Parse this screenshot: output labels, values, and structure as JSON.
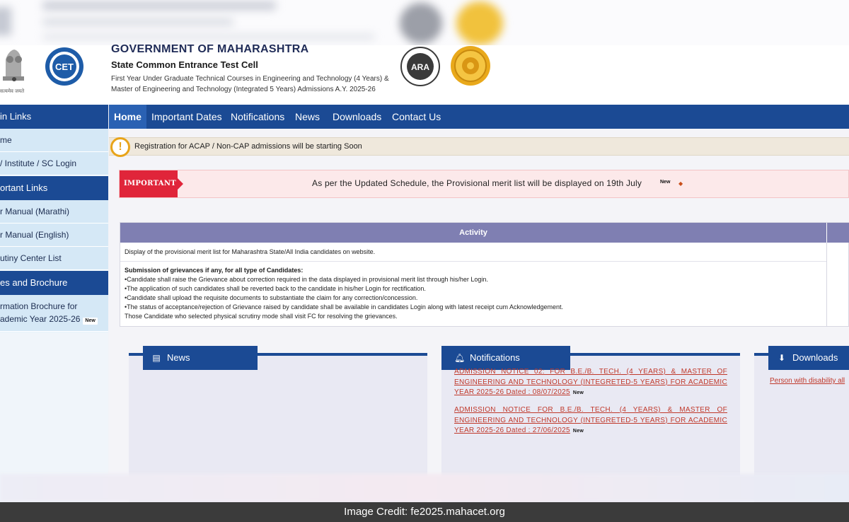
{
  "header": {
    "emblem_caption": "सत्यमेव जयते",
    "government": "GOVERNMENT OF MAHARASHTRA",
    "cell": "State Common Entrance Test Cell",
    "subtitle_line1": "First Year Under Graduate Technical Courses in Engineering and Technology (4 Years) &",
    "subtitle_line2": "Master of Engineering and Technology (Integrated 5 Years) Admissions A.Y. 2025-26",
    "cet_logo_text": "CET",
    "ara_logo_text": "ARA"
  },
  "nav": {
    "items": [
      "Home",
      "Important Dates",
      "Notifications",
      "News",
      "Downloads",
      "Contact Us"
    ]
  },
  "sidebar": {
    "head_main": "in Links",
    "item_home": "me",
    "item_login": "/ Institute / SC Login",
    "head_important": "ortant Links",
    "item_manual_marathi": "r Manual (Marathi)",
    "item_manual_english": "r Manual (English)",
    "item_scrutiny": "utiny Center List",
    "head_brochure": "es and Brochure",
    "item_brochure_line1": "rmation Brochure for",
    "item_brochure_line2": "ademic Year 2025-26",
    "new_label": "New"
  },
  "alert": {
    "text": "Registration for ACAP / Non-CAP admissions will be starting Soon"
  },
  "important": {
    "tag": "IMPORTANT",
    "text": "As per the Updated Schedule, the Provisional merit list will be displayed on 19th July",
    "new_label": "New"
  },
  "activity": {
    "heading": "Activity",
    "row1": "Display of the provisional merit list for Maharashtra State/All India candidates on website.",
    "row2_title": "Submission of grievances if any, for all type of Candidates:",
    "row2_lines": [
      "•Candidate shall raise the Grievance about correction required in the data displayed in provisional merit list through his/her Login.",
      "•The application of such candidates shall be reverted back to the candidate in his/her Login for rectification.",
      "•Candidate shall upload the requisite documents to substantiate the claim for any correction/concession.",
      "•The status of acceptance/rejection of Grievance raised by candidate shall be available in candidates Login along with latest receipt cum Acknowledgement.",
      "Those Candidate who selected physical scrutiny mode shall visit FC for resolving the grievances."
    ]
  },
  "panels": {
    "news_title": "News",
    "notifications_title": "Notifications",
    "downloads_title": "Downloads",
    "notifications": [
      {
        "text": "ADMISSION NOTICE 02: FOR B.E./B. TECH. (4 YEARS) & MASTER OF ENGINEERING AND TECHNOLOGY (INTEGRETED-5 YEARS) FOR ACADEMIC YEAR 2025-26 Dated : 08/07/2025",
        "badge": "New"
      },
      {
        "text": "ADMISSION NOTICE FOR B.E./B. TECH. (4 YEARS) & MASTER OF ENGINEERING AND TECHNOLOGY (INTEGRETED-5 YEARS) FOR ACADEMIC YEAR 2025-26 Dated : 27/06/2025",
        "badge": "New"
      }
    ],
    "downloads_link": "Person with disability all"
  },
  "credit": "Image Credit: fe2025.mahacet.org",
  "colors": {
    "nav_blue": "#1b4a94",
    "home_blue": "#2a61b3",
    "important_red": "#e0253a",
    "activity_purple": "#7f7fb2",
    "link_red": "#c0392b",
    "warning_orange": "#e8a41a"
  }
}
